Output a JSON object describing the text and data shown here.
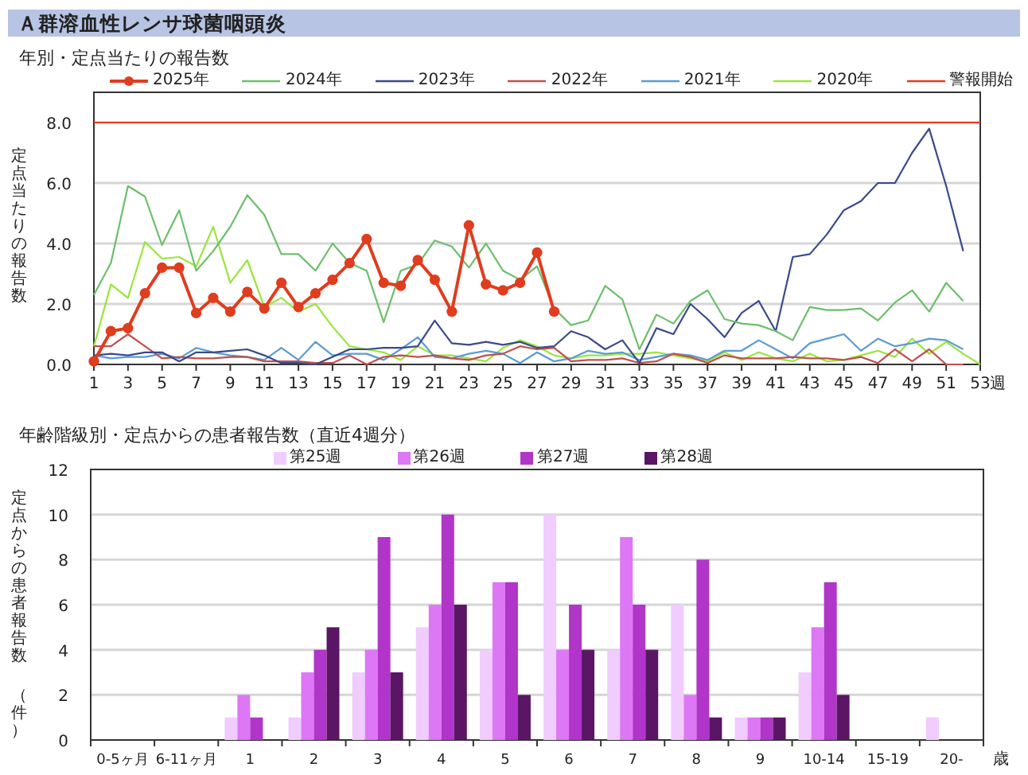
{
  "title": "Ａ群溶血性レンサ球菌咽頭炎",
  "weekly": {
    "title": "年別・定点当たりの報告数",
    "ylabel": "定点当たりの報告数",
    "x_unit": "週",
    "chart_data": {
      "type": "line",
      "x": [
        1,
        2,
        3,
        4,
        5,
        6,
        7,
        8,
        9,
        10,
        11,
        12,
        13,
        14,
        15,
        16,
        17,
        18,
        19,
        20,
        21,
        22,
        23,
        24,
        25,
        26,
        27,
        28,
        29,
        30,
        31,
        32,
        33,
        34,
        35,
        36,
        37,
        38,
        39,
        40,
        41,
        42,
        43,
        44,
        45,
        46,
        47,
        48,
        49,
        50,
        51,
        52,
        53
      ],
      "xlim": [
        1,
        53
      ],
      "ylim": [
        0,
        9
      ],
      "grid": true,
      "yticks": [
        {
          "value": 0,
          "label": "0.0"
        },
        {
          "value": 2,
          "label": "2.0"
        },
        {
          "value": 4,
          "label": "4.0"
        },
        {
          "value": 6,
          "label": "6.0"
        },
        {
          "value": 8,
          "label": "8.0"
        }
      ],
      "xticks": [
        1,
        3,
        5,
        7,
        9,
        11,
        13,
        15,
        17,
        19,
        21,
        23,
        25,
        27,
        29,
        31,
        33,
        35,
        37,
        39,
        41,
        43,
        45,
        47,
        49,
        51,
        53
      ],
      "series": [
        {
          "name": "2025年",
          "color": "#e03c1e",
          "marker": "circle",
          "values": [
            0.1,
            1.1,
            1.2,
            2.35,
            3.2,
            3.2,
            1.7,
            2.2,
            1.75,
            2.4,
            1.85,
            2.7,
            1.9,
            2.35,
            2.8,
            3.35,
            4.15,
            2.7,
            2.6,
            3.45,
            2.8,
            1.75,
            4.6,
            2.65,
            2.45,
            2.7,
            3.7,
            1.75,
            null,
            null,
            null,
            null,
            null,
            null,
            null,
            null,
            null,
            null,
            null,
            null,
            null,
            null,
            null,
            null,
            null,
            null,
            null,
            null,
            null,
            null,
            null,
            null,
            null
          ]
        },
        {
          "name": "2024年",
          "color": "#6cbf6c",
          "values": [
            2.3,
            3.35,
            5.9,
            5.55,
            3.95,
            5.1,
            3.1,
            3.75,
            4.55,
            5.6,
            4.95,
            3.65,
            3.65,
            3.1,
            4.0,
            3.35,
            3.1,
            1.4,
            3.1,
            3.3,
            4.1,
            3.9,
            3.2,
            4.0,
            3.1,
            2.8,
            3.25,
            1.85,
            1.3,
            1.45,
            2.6,
            2.15,
            0.5,
            1.65,
            1.35,
            2.1,
            2.45,
            1.5,
            1.35,
            1.3,
            1.1,
            0.8,
            1.9,
            1.8,
            1.8,
            1.85,
            1.45,
            2.05,
            2.45,
            1.75,
            2.7,
            2.1,
            null
          ]
        },
        {
          "name": "2023年",
          "color": "#3b4a8a",
          "values": [
            0.3,
            0.35,
            0.3,
            0.4,
            0.4,
            0.1,
            0.4,
            0.4,
            0.45,
            0.5,
            0.3,
            0.05,
            0.05,
            0.0,
            0.25,
            0.5,
            0.5,
            0.55,
            0.55,
            0.6,
            1.45,
            0.7,
            0.65,
            0.75,
            0.65,
            0.75,
            0.55,
            0.6,
            1.1,
            0.9,
            0.5,
            0.8,
            0.05,
            1.2,
            1.0,
            2.0,
            1.5,
            0.9,
            1.7,
            2.1,
            1.1,
            3.55,
            3.65,
            4.3,
            5.1,
            5.4,
            6.0,
            6.0,
            7.0,
            7.8,
            5.9,
            3.75,
            null
          ]
        },
        {
          "name": "2022年",
          "color": "#c0504d",
          "values": [
            0.6,
            0.6,
            1.0,
            0.6,
            0.2,
            0.25,
            0.2,
            0.2,
            0.25,
            0.25,
            0.1,
            0.1,
            0.1,
            0.05,
            0.05,
            0.3,
            0.0,
            0.25,
            0.3,
            0.25,
            0.3,
            0.2,
            0.15,
            0.3,
            0.35,
            0.6,
            0.5,
            0.55,
            0.1,
            0.15,
            0.15,
            0.2,
            0.05,
            0.1,
            0.35,
            0.25,
            0.05,
            0.3,
            0.2,
            0.2,
            0.2,
            0.25,
            0.2,
            0.2,
            0.15,
            0.25,
            0.05,
            0.5,
            0.1,
            0.5,
            0.0,
            0.0,
            null
          ]
        },
        {
          "name": "2021年",
          "color": "#5b9bd5",
          "values": [
            0.3,
            0.2,
            0.25,
            0.25,
            0.35,
            0.2,
            0.55,
            0.4,
            0.3,
            0.25,
            0.15,
            0.55,
            0.15,
            0.75,
            0.3,
            0.35,
            0.35,
            0.15,
            0.5,
            0.9,
            0.25,
            0.2,
            0.35,
            0.45,
            0.35,
            0.05,
            0.4,
            0.1,
            0.2,
            0.45,
            0.35,
            0.4,
            0.15,
            0.25,
            0.35,
            0.3,
            0.15,
            0.45,
            0.45,
            0.8,
            0.5,
            0.2,
            0.7,
            0.85,
            1.0,
            0.45,
            0.85,
            0.6,
            0.7,
            0.85,
            0.8,
            0.5,
            null
          ]
        },
        {
          "name": "2020年",
          "color": "#99e63a",
          "values": [
            0.6,
            2.65,
            2.2,
            4.05,
            3.5,
            3.55,
            3.25,
            4.55,
            2.7,
            3.45,
            1.9,
            2.2,
            1.75,
            2.0,
            1.25,
            0.6,
            0.5,
            0.4,
            0.15,
            0.6,
            0.3,
            0.3,
            0.2,
            0.1,
            0.55,
            0.8,
            0.6,
            0.3,
            0.2,
            0.3,
            0.3,
            0.35,
            0.35,
            0.4,
            0.3,
            0.2,
            0.1,
            0.4,
            0.15,
            0.4,
            0.2,
            0.1,
            0.35,
            0.1,
            0.15,
            0.3,
            0.45,
            0.25,
            0.85,
            0.35,
            0.75,
            0.35,
            0.0
          ]
        },
        {
          "name": "警報開始",
          "color": "#e8391e",
          "values": [
            8,
            8,
            8,
            8,
            8,
            8,
            8,
            8,
            8,
            8,
            8,
            8,
            8,
            8,
            8,
            8,
            8,
            8,
            8,
            8,
            8,
            8,
            8,
            8,
            8,
            8,
            8,
            8,
            8,
            8,
            8,
            8,
            8,
            8,
            8,
            8,
            8,
            8,
            8,
            8,
            8,
            8,
            8,
            8,
            8,
            8,
            8,
            8,
            8,
            8,
            8,
            8,
            8
          ]
        }
      ]
    }
  },
  "age": {
    "title": "年齢階級別・定点からの患者報告数（直近4週分）",
    "ylabel": "定点からの患者報告数",
    "ylabel_unit": "（件）",
    "x_unit": "歳",
    "chart_data": {
      "type": "bar",
      "categories": [
        "0-5ヶ月",
        "6-11ヶ月",
        "1",
        "2",
        "3",
        "4",
        "5",
        "6",
        "7",
        "8",
        "9",
        "10-14",
        "15-19",
        "20-"
      ],
      "ylim": [
        0,
        12
      ],
      "grid": true,
      "yticks": [
        0,
        2,
        4,
        6,
        8,
        10,
        12
      ],
      "series": [
        {
          "name": "第25週",
          "color": "#f0ccff",
          "values": [
            0,
            0,
            1,
            1,
            3,
            5,
            4,
            10,
            4,
            6,
            1,
            3,
            0,
            1
          ]
        },
        {
          "name": "第26週",
          "color": "#dd77f5",
          "values": [
            0,
            0,
            2,
            3,
            4,
            6,
            7,
            4,
            9,
            2,
            1,
            5,
            0,
            0
          ]
        },
        {
          "name": "第27週",
          "color": "#b035c8",
          "values": [
            0,
            0,
            1,
            4,
            9,
            10,
            7,
            6,
            6,
            8,
            1,
            7,
            0,
            0
          ]
        },
        {
          "name": "第28週",
          "color": "#5a1565",
          "values": [
            0,
            0,
            0,
            5,
            3,
            6,
            2,
            4,
            4,
            1,
            1,
            2,
            0,
            0
          ]
        }
      ]
    }
  }
}
